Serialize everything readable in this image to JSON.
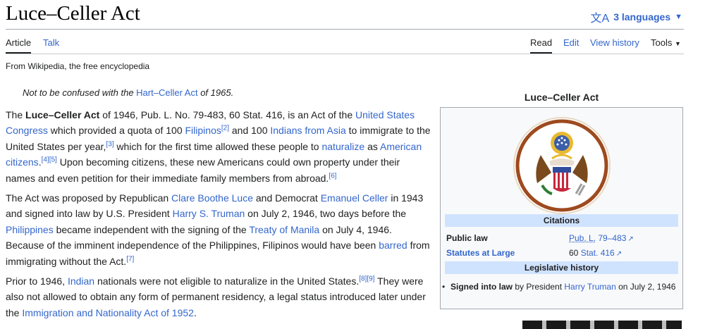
{
  "page": {
    "title": "Luce–Celler Act",
    "languages": "3 languages",
    "tabs_left": [
      "Article",
      "Talk"
    ],
    "tabs_right": [
      "Read",
      "Edit",
      "View history",
      "Tools"
    ],
    "from": "From Wikipedia, the free encyclopedia"
  },
  "hatnote": {
    "prefix": "Not to be confused with the ",
    "link": "Hart–Celler Act",
    "suffix": " of 1965."
  },
  "article": {
    "p1": {
      "t1": "The ",
      "bold": "Luce–Celler Act",
      "t2": " of 1946, Pub. L. No. 79-483, 60 Stat. 416, is an Act of the ",
      "l1": "United States Congress",
      "t3": " which provided a quota of 100 ",
      "l2": "Filipinos",
      "r1": "[2]",
      "t4": " and 100 ",
      "l3": "Indians from Asia",
      "t5": " to immigrate to the United States per year,",
      "r2": "[3]",
      "t6": " which for the first time allowed these people to ",
      "l4": "naturalize",
      "t7": " as ",
      "l5": "American citizens",
      "t8": ".",
      "r3": "[4]",
      "r4": "[5]",
      "t9": " Upon becoming citizens, these new Americans could own property under their names and even petition for their immediate family members from abroad.",
      "r5": "[6]"
    },
    "p2": {
      "t1": "The Act was proposed by Republican ",
      "l1": "Clare Boothe Luce",
      "t2": " and Democrat ",
      "l2": "Emanuel Celler",
      "t3": " in 1943 and signed into law by U.S. President ",
      "l3": "Harry S. Truman",
      "t4": " on July 2, 1946, two days before the ",
      "l4": "Philippines",
      "t5": " became independent with the signing of the ",
      "l5": "Treaty of Manila",
      "t6": " on July 4, 1946. Because of the imminent independence of the Philippines, Filipinos would have been ",
      "l6": "barred",
      "t7": " from immigrating without the Act.",
      "r1": "[7]"
    },
    "p3": {
      "t1": "Prior to 1946, ",
      "l1": "Indian",
      "t2": " nationals were not eligible to naturalize in the United States.",
      "r1": "[8]",
      "r2": "[9]",
      "t3": " They were also not allowed to obtain any form of permanent residency, a legal status introduced later under the ",
      "l2": "Immigration and Nationality Act of 1952",
      "t4": "."
    }
  },
  "infobox": {
    "caption": "Luce–Celler Act",
    "citations_header": "Citations",
    "public_law_label": "Public law",
    "public_law_link1": "Pub. L.",
    "public_law_link2": "79–483",
    "statutes_label": "Statutes at Large",
    "statutes_prefix": "60 ",
    "statutes_link": "Stat. 416",
    "legislative_header": "Legislative history",
    "signed_bold": "Signed into law",
    "signed_t1": " by President ",
    "signed_link": "Harry Truman",
    "signed_t2": " on July 2, 1946"
  },
  "colors": {
    "link": "#3366cc",
    "infobox_header": "#cfe3ff",
    "infobox_bg": "#f8f9fa",
    "border": "#a2a9b1"
  },
  "icons": [
    "translate-icon",
    "chevron-down-icon",
    "external-link-icon",
    "great-seal-image"
  ]
}
